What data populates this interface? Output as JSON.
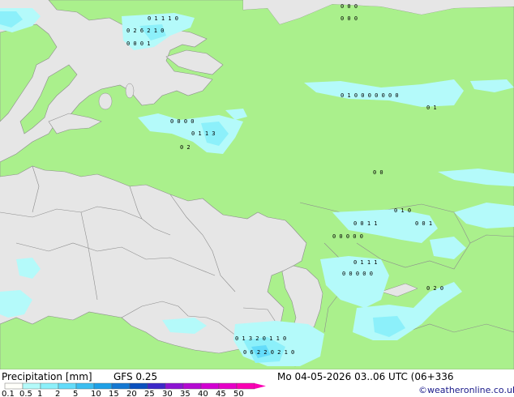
{
  "legend": {
    "title": "Precipitation [mm]",
    "model": "GFS 0.25",
    "ticks": [
      "0.1",
      "0.5",
      "1",
      "2",
      "5",
      "10",
      "15",
      "20",
      "25",
      "30",
      "35",
      "40",
      "45",
      "50"
    ],
    "colors": [
      "#fffffa",
      "#b4fafa",
      "#8cf0fa",
      "#64dcfa",
      "#3cbef0",
      "#1ea0e6",
      "#1478d2",
      "#0a50be",
      "#3c28c8",
      "#8c14d2",
      "#b40ad2",
      "#d200d2",
      "#e600c8",
      "#fa00b4"
    ]
  },
  "valid_time": "Mo 04-05-2026 03..06 UTC (06+336",
  "credit": "©weatheronline.co.uk",
  "map_colors": {
    "sea": "#e6e6e6",
    "land": "#aaf08c",
    "border": "#8c8c8c"
  },
  "grid_values": [
    "0 1 1 1 0",
    "0 2 6 2 1 0",
    "0 0 0 1",
    "0 0 0",
    "0 0 0",
    "0 1 0 0 0 0 0 0 0",
    "0 1",
    "0 0 0 0",
    "0 1 1 3",
    "0 2",
    "0 0",
    "0 1 0",
    "0 0 1 1",
    "0 0 1",
    "0 0 0 0 0",
    "0 1 1 1",
    "0 0 0 0 0",
    "0 2 0",
    "0 1 3 2 0 1 1 0",
    "0 6 2 2 0 2 1 0"
  ]
}
